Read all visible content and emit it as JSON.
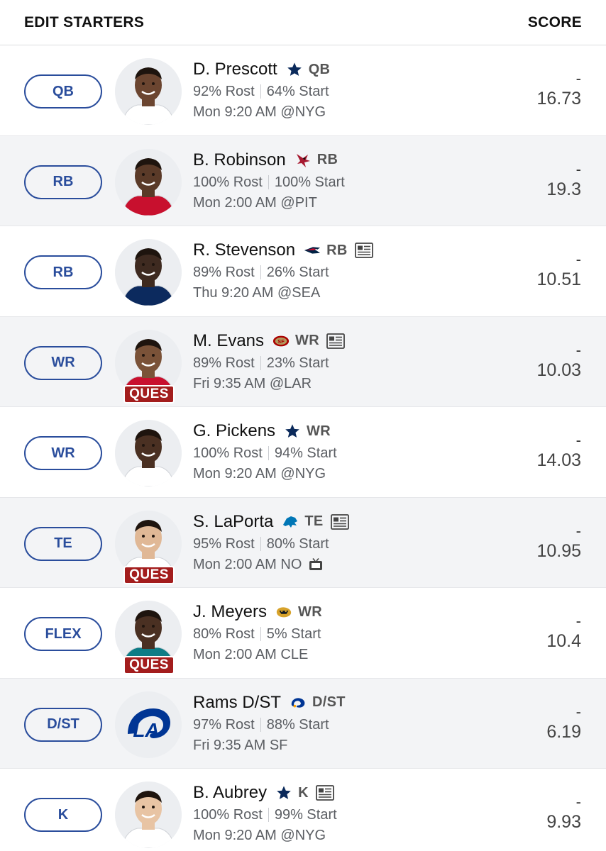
{
  "header": {
    "left": "EDIT STARTERS",
    "right": "SCORE"
  },
  "players": [
    {
      "slot": "QB",
      "name": "D. Prescott",
      "team_icon": "star-icon",
      "team_color": "#0b2a5b",
      "pos": "QB",
      "news": false,
      "rost": "92% Rost",
      "start": "64% Start",
      "game": "Mon 9:20 AM @NYG",
      "tv": false,
      "ques": "",
      "dash": "-",
      "score": "16.73",
      "jersey": "#ffffff",
      "skin": "#6b4530"
    },
    {
      "slot": "RB",
      "name": "B. Robinson",
      "team_icon": "falcon-icon",
      "team_color": "#a71930",
      "pos": "RB",
      "news": false,
      "rost": "100% Rost",
      "start": "100% Start",
      "game": "Mon 2:00 AM @PIT",
      "tv": false,
      "ques": "",
      "dash": "-",
      "score": "19.3",
      "jersey": "#c8102e",
      "skin": "#5a3a28"
    },
    {
      "slot": "RB",
      "name": "R. Stevenson",
      "team_icon": "patriots-icon",
      "team_color": "#002244",
      "pos": "RB",
      "news": true,
      "rost": "89% Rost",
      "start": "26% Start",
      "game": "Thu 9:20 AM @SEA",
      "tv": false,
      "ques": "",
      "dash": "-",
      "score": "10.51",
      "jersey": "#0c2a5e",
      "skin": "#3e2a20"
    },
    {
      "slot": "WR",
      "name": "M. Evans",
      "team_icon": "49ers-icon",
      "team_color": "#aa0000",
      "pos": "WR",
      "news": true,
      "rost": "89% Rost",
      "start": "23% Start",
      "game": "Fri 9:35 AM @LAR",
      "tv": false,
      "ques": "QUES",
      "dash": "-",
      "score": "10.03",
      "jersey": "#c8102e",
      "skin": "#7a5238"
    },
    {
      "slot": "WR",
      "name": "G. Pickens",
      "team_icon": "star-icon",
      "team_color": "#0b2a5b",
      "pos": "WR",
      "news": false,
      "rost": "100% Rost",
      "start": "94% Start",
      "game": "Mon 9:20 AM @NYG",
      "tv": false,
      "ques": "",
      "dash": "-",
      "score": "14.03",
      "jersey": "#ffffff",
      "skin": "#4a3022"
    },
    {
      "slot": "TE",
      "name": "S. LaPorta",
      "team_icon": "lion-icon",
      "team_color": "#0076b6",
      "pos": "TE",
      "news": true,
      "rost": "95% Rost",
      "start": "80% Start",
      "game": "Mon 2:00 AM NO",
      "tv": true,
      "ques": "QUES",
      "dash": "-",
      "score": "10.95",
      "jersey": "#ffffff",
      "skin": "#e0b896"
    },
    {
      "slot": "FLEX",
      "name": "J. Meyers",
      "team_icon": "jaguar-icon",
      "team_color": "#006778",
      "pos": "WR",
      "news": false,
      "rost": "80% Rost",
      "start": "5% Start",
      "game": "Mon 2:00 AM CLE",
      "tv": false,
      "ques": "QUES",
      "dash": "-",
      "score": "10.4",
      "jersey": "#0e7c86",
      "skin": "#4a3022"
    },
    {
      "slot": "D/ST",
      "name": "Rams D/ST",
      "team_icon": "rams-icon",
      "team_color": "#003594",
      "pos": "D/ST",
      "news": false,
      "rost": "97% Rost",
      "start": "88% Start",
      "game": "Fri 9:35 AM SF",
      "tv": false,
      "ques": "",
      "dash": "-",
      "score": "6.19",
      "jersey": "",
      "skin": "",
      "logo_text": "LA"
    },
    {
      "slot": "K",
      "name": "B. Aubrey",
      "team_icon": "star-icon",
      "team_color": "#0b2a5b",
      "pos": "K",
      "news": true,
      "rost": "100% Rost",
      "start": "99% Start",
      "game": "Mon 9:20 AM @NYG",
      "tv": false,
      "ques": "",
      "dash": "-",
      "score": "9.93",
      "jersey": "#ffffff",
      "skin": "#e8c4a4"
    }
  ]
}
